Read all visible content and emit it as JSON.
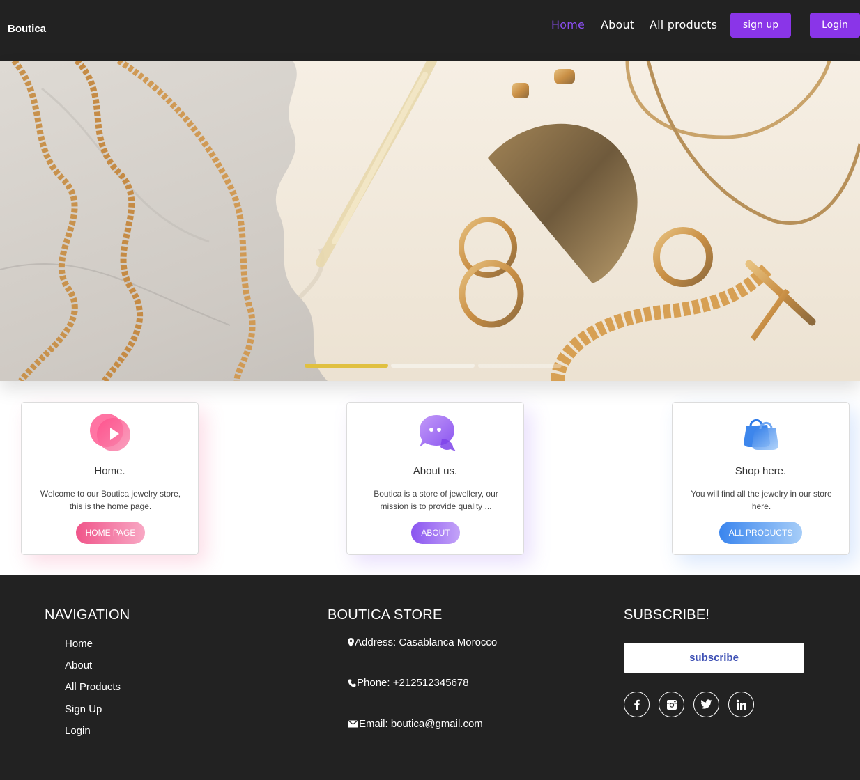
{
  "navbar": {
    "brand": "Boutica",
    "links": [
      {
        "label": "Home",
        "active": true
      },
      {
        "label": "About",
        "active": false
      },
      {
        "label": "All products",
        "active": false
      }
    ],
    "signup_label": "sign up",
    "login_label": "Login",
    "accent_color": "#8a35e8"
  },
  "hero": {
    "slides_count": 3,
    "active_slide": 1
  },
  "cards": [
    {
      "icon": "play-icon",
      "title": "Home.",
      "text": "Welcome to our Boutica jewelry store, this is the home page.",
      "button": "HOME PAGE",
      "color": "#f06292"
    },
    {
      "icon": "chat-icon",
      "title": "About us.",
      "text": "Boutica is a store of jewellery, our mission is to provide quality ...",
      "button": "ABOUT",
      "color": "#9c6cf0"
    },
    {
      "icon": "shopping-bag-icon",
      "title": "Shop here.",
      "text": "You will find all the jewelry in our store here.",
      "button": "ALL PRODUCTS",
      "color": "#4a8ef0"
    }
  ],
  "footer": {
    "navigation": {
      "heading": "NAVIGATION",
      "links": [
        "Home",
        "About",
        "All Products",
        "Sign Up",
        "Login"
      ]
    },
    "store": {
      "heading": "BOUTICA STORE",
      "address": "Address: Casablanca Morocco",
      "phone": "Phone: +212512345678",
      "email": "Email: boutica@gmail.com"
    },
    "subscribe": {
      "heading": "SUBSCRIBE!",
      "button": "subscribe",
      "socials": [
        "facebook-icon",
        "instagram-icon",
        "twitter-icon",
        "linkedin-icon"
      ]
    }
  }
}
